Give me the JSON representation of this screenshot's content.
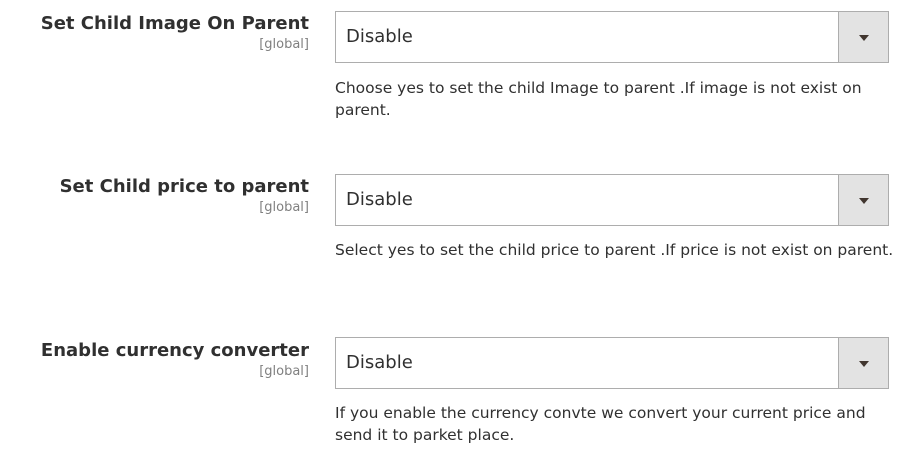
{
  "fields": [
    {
      "label": "Set Child Image On Parent",
      "scope": "[global]",
      "value": "Disable",
      "note": "Choose yes to set the child Image to parent .If image is not exist on parent."
    },
    {
      "label": "Set Child price to parent",
      "scope": "[global]",
      "value": "Disable",
      "note": "Select yes to set the child price to parent .If price is not exist on parent."
    },
    {
      "label": "Enable currency converter",
      "scope": "[global]",
      "value": "Disable",
      "note": "If you enable the currency convte we convert your current price and send it to parket place."
    }
  ],
  "icons": {
    "dropdown": "chevron-down-icon"
  }
}
